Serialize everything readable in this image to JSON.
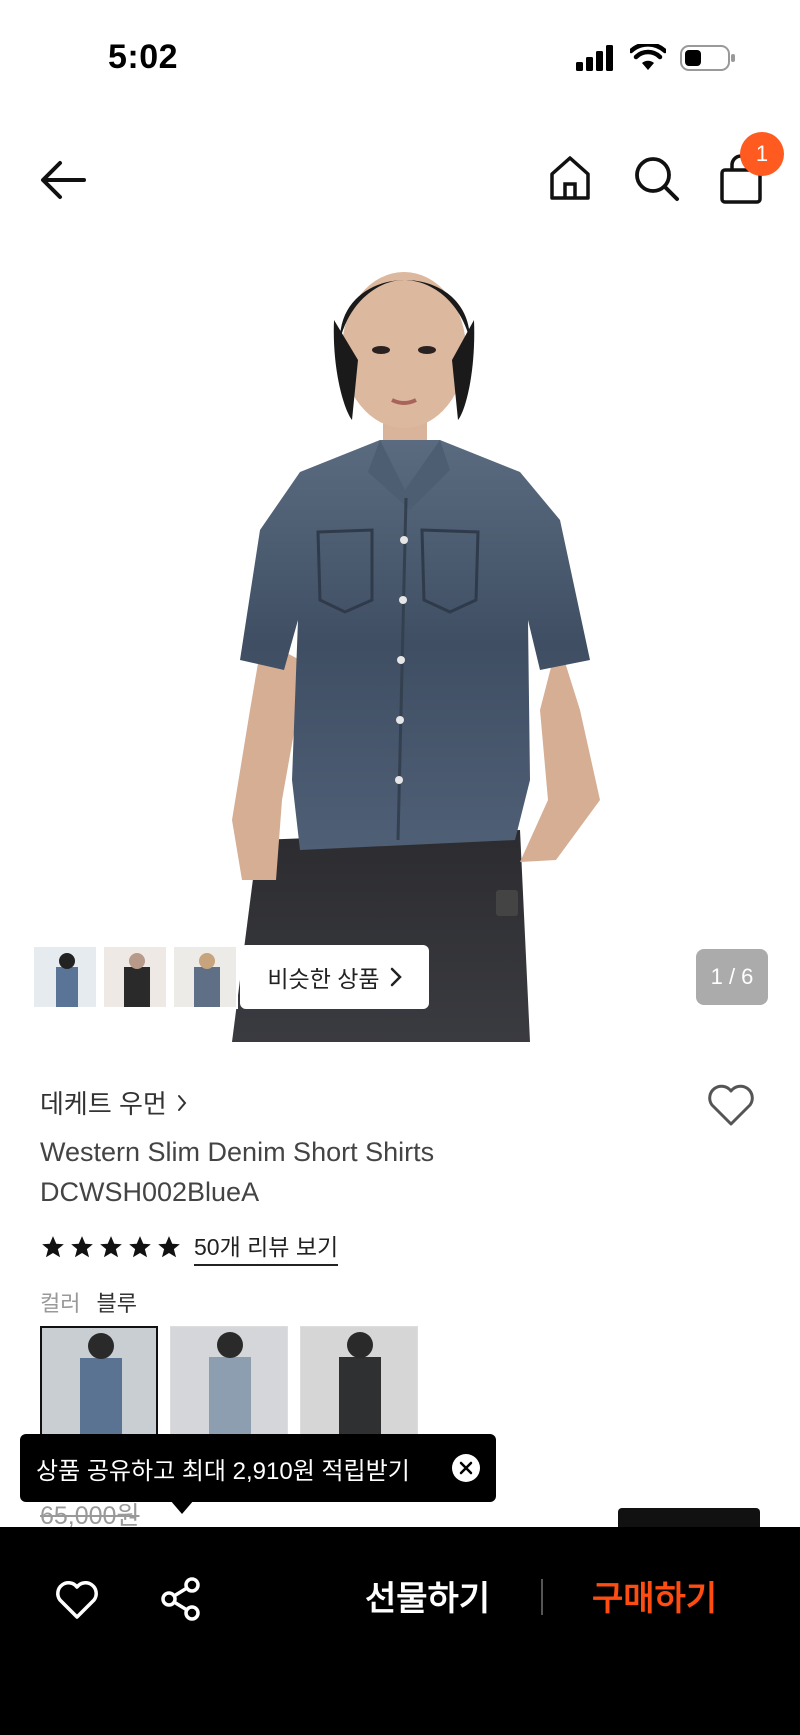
{
  "status_bar": {
    "time": "5:02"
  },
  "nav": {
    "cart_count": "1"
  },
  "hero": {
    "similar_button": "비슷한 상품",
    "page_counter": "1 / 6"
  },
  "product": {
    "brand": "데케트 우먼",
    "name_line1": "Western Slim Denim Short Shirts",
    "name_line2": "DCWSH002BlueA",
    "rating_stars": 5,
    "review_link": "50개 리뷰 보기",
    "color_label": "컬러",
    "color_value": "블루",
    "original_price": "65,000원"
  },
  "toast": {
    "text": "상품 공유하고 최대 2,910원 적립받기"
  },
  "bottom_bar": {
    "gift_label": "선물하기",
    "buy_label": "구매하기"
  },
  "colors": {
    "accent": "#ff4d12",
    "badge": "#ff5a1f",
    "bottom_bar_bg": "#000000"
  },
  "icons": [
    "back-arrow-icon",
    "home-icon",
    "search-icon",
    "shopping-bag-icon",
    "heart-icon",
    "share-icon",
    "close-icon",
    "chevron-right-icon",
    "star-icon"
  ]
}
